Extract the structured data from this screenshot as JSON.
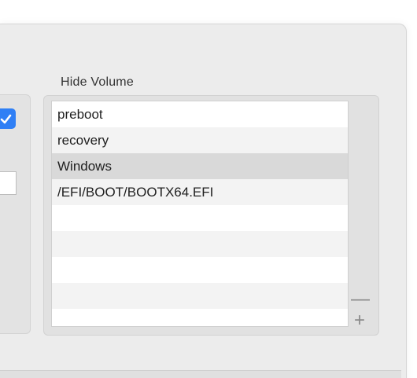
{
  "hide_volume": {
    "title": "Hide Volume",
    "items": [
      {
        "label": "preboot"
      },
      {
        "label": "recovery"
      },
      {
        "label": "Windows"
      },
      {
        "label": "/EFI/BOOT/BOOTX64.EFI"
      }
    ],
    "selected_index": 2,
    "remove_label": "—",
    "add_label": "+"
  },
  "colors": {
    "accent": "#2f7ff5",
    "window_bg": "#ececec",
    "selected_row": "#d9d9d9"
  }
}
